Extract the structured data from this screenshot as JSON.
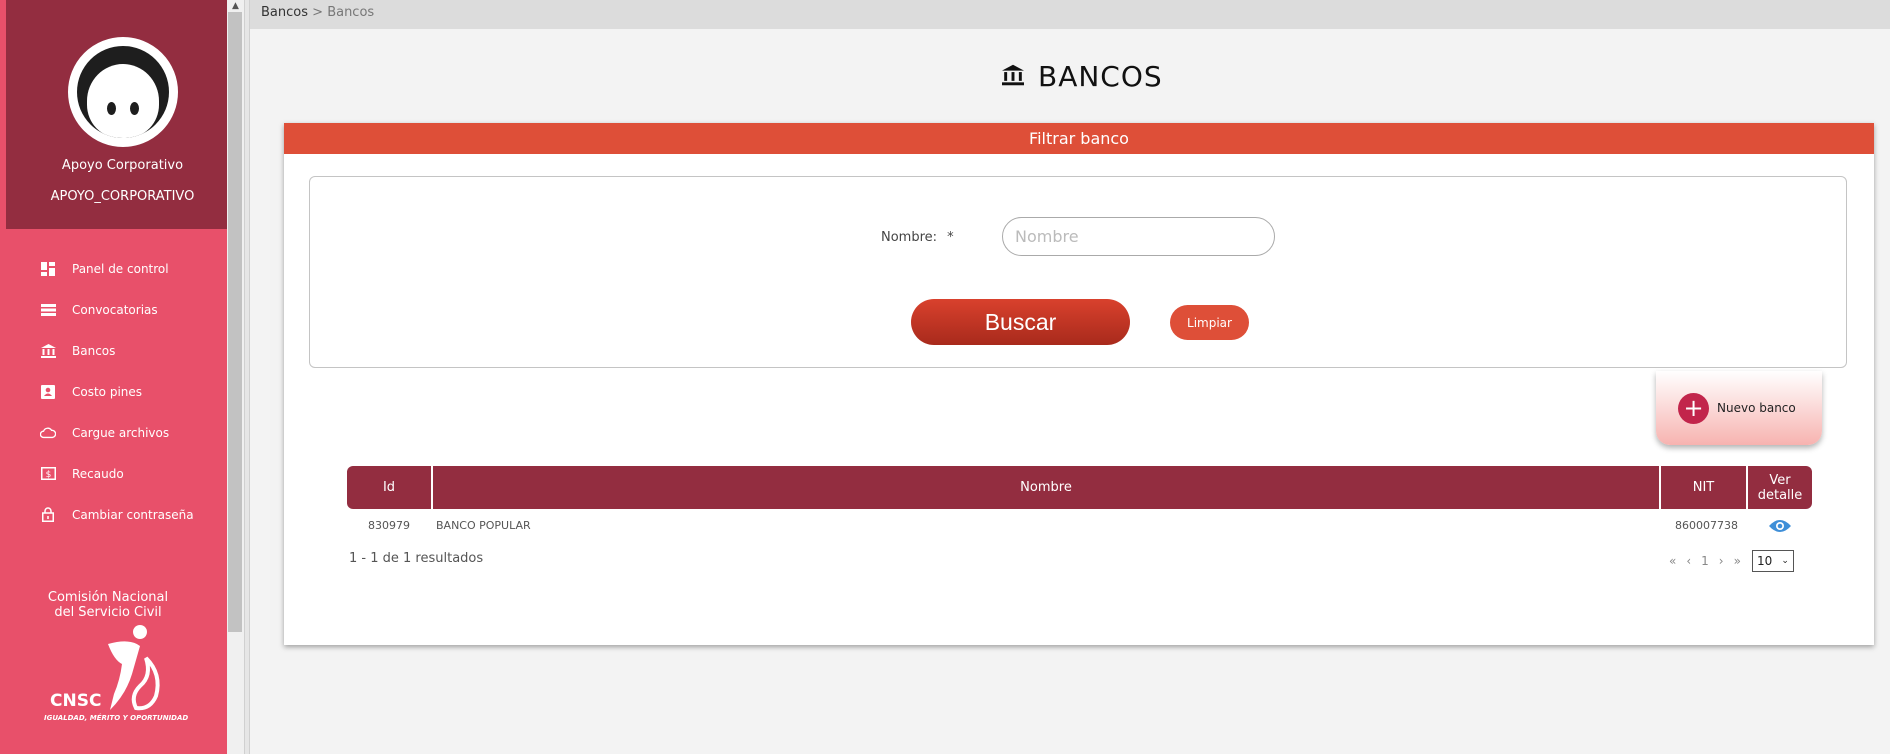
{
  "profile": {
    "name": "Apoyo Corporativo",
    "role": "APOYO_CORPORATIVO"
  },
  "menu": [
    {
      "label": "Panel de control",
      "icon": "dashboard-icon"
    },
    {
      "label": "Convocatorias",
      "icon": "list-icon"
    },
    {
      "label": "Bancos",
      "icon": "bank-icon"
    },
    {
      "label": "Costo pines",
      "icon": "contact-card-icon"
    },
    {
      "label": "Cargue archivos",
      "icon": "cloud-upload-icon"
    },
    {
      "label": "Recaudo",
      "icon": "dollar-bill-icon"
    },
    {
      "label": "Cambiar contraseña",
      "icon": "lock-icon"
    }
  ],
  "logo": {
    "title_line1": "Comisión Nacional",
    "title_line2": "del Servicio Civil",
    "acronym": "CNSC",
    "tagline": "IGUALDAD, MÉRITO Y OPORTUNIDAD"
  },
  "breadcrumb": {
    "root": "Bancos",
    "separator": ">",
    "current": "Bancos"
  },
  "page": {
    "title": "BANCOS"
  },
  "filter": {
    "header": "Filtrar banco",
    "nombre_label": "Nombre:",
    "required_mark": "*",
    "nombre_placeholder": "Nombre",
    "nombre_value": "",
    "search_label": "Buscar",
    "clear_label": "Limpiar"
  },
  "new_bank": {
    "label": "Nuevo banco"
  },
  "table": {
    "columns": [
      "Id",
      "Nombre",
      "NIT",
      "Ver detalle"
    ],
    "rows": [
      {
        "id": "830979",
        "nombre": "BANCO POPULAR",
        "nit": "860007738"
      }
    ]
  },
  "pagination": {
    "summary": "1 - 1 de 1 resultados",
    "current_page": "1",
    "page_size": "10"
  },
  "colors": {
    "sidebar": "#e8506a",
    "profile_bg": "#932d40",
    "accent": "#de4f38",
    "table_header": "#932d40"
  }
}
